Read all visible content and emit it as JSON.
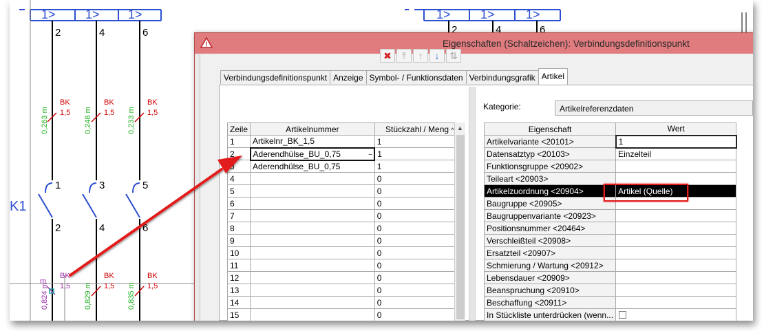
{
  "colors": {
    "accent": "#e21b1b",
    "title_bar": "#e07b7e",
    "wire_green": "#1fb21f",
    "conductor_label": "#d00000",
    "schematic_blue": "#2c4fd0",
    "selection": "#000000"
  },
  "schematic": {
    "left_terminals": [
      "2",
      "4",
      "6"
    ],
    "right_terminals": [
      "2",
      "4",
      "6"
    ],
    "breaker_label": "1>",
    "device_tag": "K1",
    "contact_top": [
      "1",
      "3",
      "5"
    ],
    "contact_bottom": [
      "2",
      "4",
      "6"
    ],
    "wires_upper": [
      {
        "length": "0,263 m",
        "color": "BK",
        "section": "1,5"
      },
      {
        "length": "0,248 m",
        "color": "BK",
        "section": "1,5"
      },
      {
        "length": "0,233 m",
        "color": "BK",
        "section": "1,5"
      }
    ],
    "wires_lower": [
      {
        "length": "0,824 m",
        "color": "BK",
        "section": "1,5"
      },
      {
        "length": "0,829 m",
        "color": "BK",
        "section": "1,5"
      },
      {
        "length": "0,835 m",
        "color": "BK",
        "section": "1,5"
      }
    ]
  },
  "dialog": {
    "title": "Eigenschaften (Schaltzeichen): Verbindungsdefinitionspunkt",
    "warning_icon": "warning-icon",
    "tabs": [
      {
        "label": "Verbindungsdefinitionspunkt"
      },
      {
        "label": "Anzeige"
      },
      {
        "label": "Symbol- / Funktionsdaten"
      },
      {
        "label": "Verbindungsgrafik"
      },
      {
        "label": "Artikel"
      }
    ],
    "active_tab": "Artikel",
    "toolbar": [
      {
        "icon": "delete-icon",
        "glyph": "✖"
      },
      {
        "icon": "move-top-icon",
        "glyph": "⤒"
      },
      {
        "icon": "move-up-icon",
        "glyph": "↑"
      },
      {
        "icon": "move-down-icon",
        "glyph": "↓"
      },
      {
        "icon": "swap-icon",
        "glyph": "⇅"
      }
    ],
    "articles": {
      "headers": [
        "Zeile",
        "Artikelnummer",
        "Stückzahl / Meng"
      ],
      "rows": [
        {
          "num": "1",
          "article": "Artikelnr_BK_1,5",
          "qty": "1"
        },
        {
          "num": "2",
          "article": "Aderendhülse_BU_0,75",
          "qty": "1"
        },
        {
          "num": "3",
          "article": "Aderendhülse_BU_0,75",
          "qty": "1"
        },
        {
          "num": "4",
          "article": "",
          "qty": "0"
        },
        {
          "num": "5",
          "article": "",
          "qty": "0"
        },
        {
          "num": "6",
          "article": "",
          "qty": "0"
        },
        {
          "num": "7",
          "article": "",
          "qty": "0"
        },
        {
          "num": "8",
          "article": "",
          "qty": "0"
        },
        {
          "num": "9",
          "article": "",
          "qty": "0"
        },
        {
          "num": "10",
          "article": "",
          "qty": "0"
        },
        {
          "num": "11",
          "article": "",
          "qty": "0"
        },
        {
          "num": "12",
          "article": "",
          "qty": "0"
        },
        {
          "num": "13",
          "article": "",
          "qty": "0"
        },
        {
          "num": "14",
          "article": "",
          "qty": "0"
        },
        {
          "num": "15",
          "article": "",
          "qty": "0"
        }
      ],
      "selected_row": 2,
      "ellipsis": "..."
    },
    "category_label": "Kategorie:",
    "category_value": "Artikelreferenzdaten",
    "properties": {
      "headers": [
        "Eigenschaft",
        "Wert"
      ],
      "rows": [
        {
          "prop": "Artikelvariante <20101>",
          "value": "1"
        },
        {
          "prop": "Datensatztyp <20103>",
          "value": "Einzelteil"
        },
        {
          "prop": "Funktionsgruppe <20902>",
          "value": ""
        },
        {
          "prop": "Teileart <20903>",
          "value": ""
        },
        {
          "prop": "Artikelzuordnung <20904>",
          "value": "Artikel (Quelle)"
        },
        {
          "prop": "Baugruppe <20905>",
          "value": ""
        },
        {
          "prop": "Baugruppenvariante <20923>",
          "value": ""
        },
        {
          "prop": "Positionsnummer <20464>",
          "value": ""
        },
        {
          "prop": "Verschleißteil <20908>",
          "value": ""
        },
        {
          "prop": "Ersatzteil <20907>",
          "value": ""
        },
        {
          "prop": "Schmierung / Wartung <20912>",
          "value": ""
        },
        {
          "prop": "Lebensdauer <20909>",
          "value": ""
        },
        {
          "prop": "Beanspruchung <20910>",
          "value": ""
        },
        {
          "prop": "Beschaffung <20911>",
          "value": ""
        },
        {
          "prop": "In Stückliste unterdrücken (wenn...",
          "value": ""
        }
      ],
      "highlighted_row": 4
    }
  }
}
